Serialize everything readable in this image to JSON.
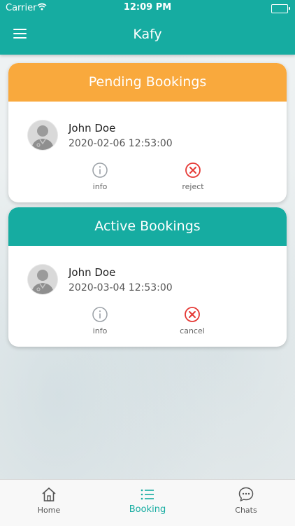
{
  "status_bar": {
    "carrier": "Carrier",
    "time": "12:09 PM"
  },
  "header": {
    "title": "Kafy"
  },
  "pending": {
    "title": "Pending Bookings",
    "name": "John Doe",
    "datetime": "2020-02-06 12:53:00",
    "actions": [
      {
        "label": "info",
        "icon": "info-icon"
      },
      {
        "label": "reject",
        "icon": "x-circle-icon"
      }
    ]
  },
  "active": {
    "title": "Active Bookings",
    "name": "John Doe",
    "datetime": "2020-03-04 12:53:00",
    "actions": [
      {
        "label": "info",
        "icon": "info-icon"
      },
      {
        "label": "cancel",
        "icon": "x-circle-icon"
      }
    ]
  },
  "tabs": [
    {
      "label": "Home",
      "icon": "home-icon"
    },
    {
      "label": "Booking",
      "icon": "list-icon",
      "selected": true
    },
    {
      "label": "Chats",
      "icon": "chat-bubble-icon"
    }
  ],
  "colors": {
    "primary": "#16aca1",
    "pending": "#f9a93d",
    "danger": "#e53935"
  }
}
